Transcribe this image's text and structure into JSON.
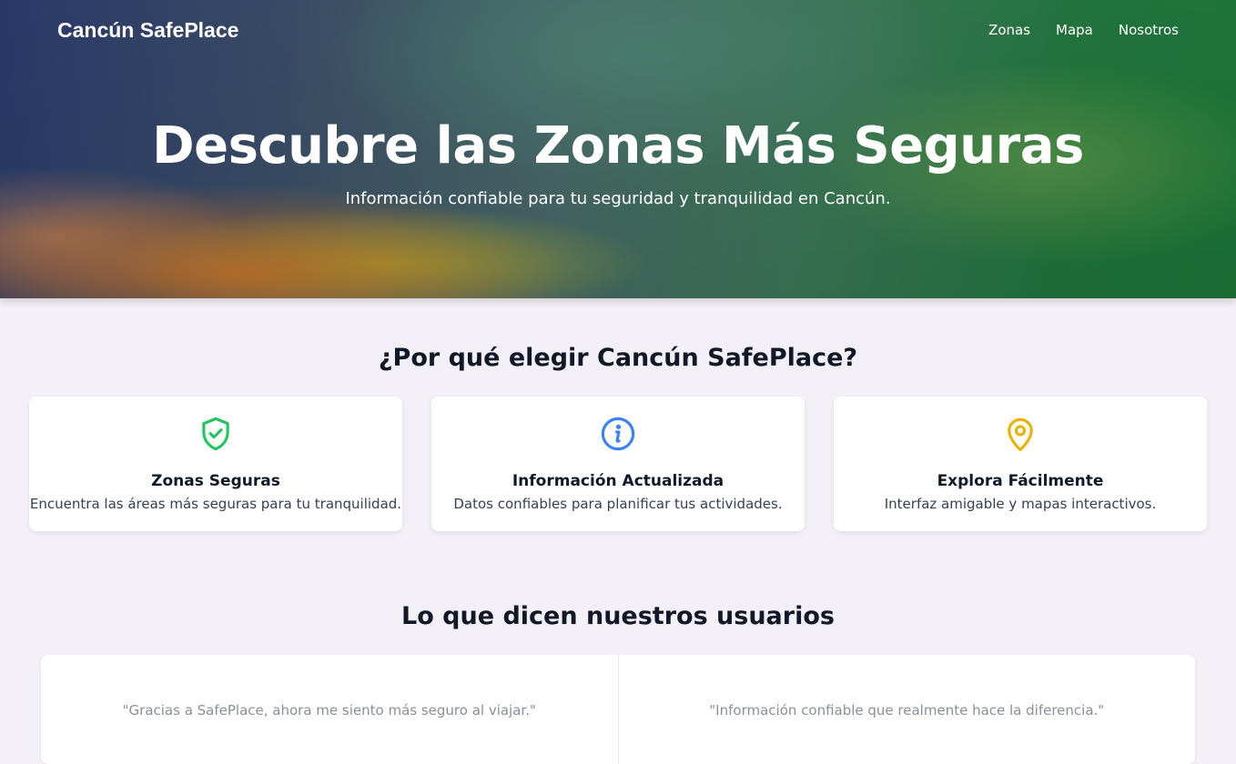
{
  "nav": {
    "brand": "Cancún SafePlace",
    "links": [
      {
        "label": "Zonas"
      },
      {
        "label": "Mapa"
      },
      {
        "label": "Nosotros"
      }
    ]
  },
  "hero": {
    "title": "Descubre las Zonas Más Seguras",
    "subtitle": "Información confiable para tu seguridad y tranquilidad en Cancún."
  },
  "why": {
    "title": "¿Por qué elegir Cancún SafePlace?",
    "cards": [
      {
        "icon": "shield-check-icon",
        "color": "#22c55e",
        "title": "Zonas Seguras",
        "desc": "Encuentra las áreas más seguras para tu tranquilidad."
      },
      {
        "icon": "info-icon",
        "color": "#3b82f6",
        "title": "Información Actualizada",
        "desc": "Datos confiables para planificar tus actividades."
      },
      {
        "icon": "map-pin-icon",
        "color": "#eab308",
        "title": "Explora Fácilmente",
        "desc": "Interfaz amigable y mapas interactivos."
      }
    ]
  },
  "testimonials": {
    "title": "Lo que dicen nuestros usuarios",
    "quotes": [
      "\"Gracias a SafePlace, ahora me siento más seguro al viajar.\"",
      "\"Información confiable que realmente hace la diferencia.\""
    ]
  }
}
